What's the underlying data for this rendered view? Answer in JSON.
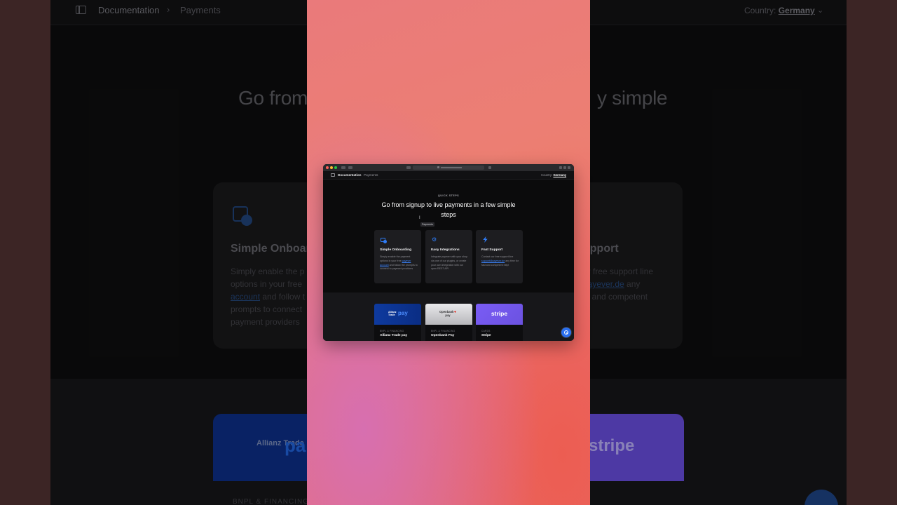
{
  "colors": {
    "accent": "#2f7cf6",
    "page_background": "#0b0b0c",
    "card_background": "#1d1d20",
    "gradient_pink": "#d76fb0",
    "gradient_coral": "#ec7f72",
    "allianz_blue": "#0e3a9e",
    "stripe_purple": "#7a5cf5"
  },
  "background": {
    "breadcrumb": {
      "documentation": "Documentation",
      "separator": "›",
      "payments": "Payments"
    },
    "country": {
      "label": "Country:",
      "value": "Germany"
    },
    "heading_left": "Go from",
    "heading_right": "y simple",
    "onboarding": {
      "title": "Simple Onboard",
      "body_lines": [
        "Simply enable the p",
        "options in your free",
        "account",
        " and follow t",
        "prompts to connect",
        "payment providers"
      ]
    },
    "support": {
      "title": "upport",
      "body_lines": [
        "ur free support line",
        "payever.de",
        " any",
        "st and competent"
      ]
    },
    "allianz": {
      "brand": "Allianz Trade",
      "pay": "pa"
    },
    "stripe": "stripe",
    "category": "BNPL & FINANCING"
  },
  "window": {
    "nav": {
      "breadcrumb_documentation": "Documentation",
      "breadcrumb_separator": "›",
      "breadcrumb_payments": "Payments",
      "country_label": "Country:",
      "country_value": "Germany",
      "country_chevron": "⌄"
    },
    "eyebrow": "QUICK STEPS",
    "headline": "Go from signup to live payments in a few simple steps",
    "cursor": "I",
    "tooltip": "Payments",
    "steps": [
      {
        "icon": "onboarding-icon",
        "title": "Simple Onboarding",
        "body_before": "Simply enable the payment options in your free ",
        "link": "payever account",
        "body_after": " and follow the prompts to connect to payment providers"
      },
      {
        "icon": "gear-icon",
        "title": "Easy Integrations",
        "body": "Integrate payever with your shop via one of our plugins, or create your own integration with our open REST API"
      },
      {
        "icon": "lightning-icon",
        "title": "Fast Support",
        "body_before": "Contact our free support line ",
        "link": "support@payever.de",
        "body_after": " any time for fast and competent help!"
      }
    ],
    "providers": [
      {
        "logo_brand_1": "Allianz",
        "logo_brand_2": "Trade",
        "logo_pay": "pay",
        "category": "BNPL & FINANCING",
        "name": "Allianz Trade pay"
      },
      {
        "logo_line_1": "Openbank",
        "logo_mark": "✚",
        "logo_line_2": "pay",
        "category": "BNPL & FINANCING",
        "name": "Openbank Pay"
      },
      {
        "logo": "stripe",
        "category": "CARDS",
        "name": "Stripe"
      }
    ],
    "fab_icon": "chat-icon"
  }
}
